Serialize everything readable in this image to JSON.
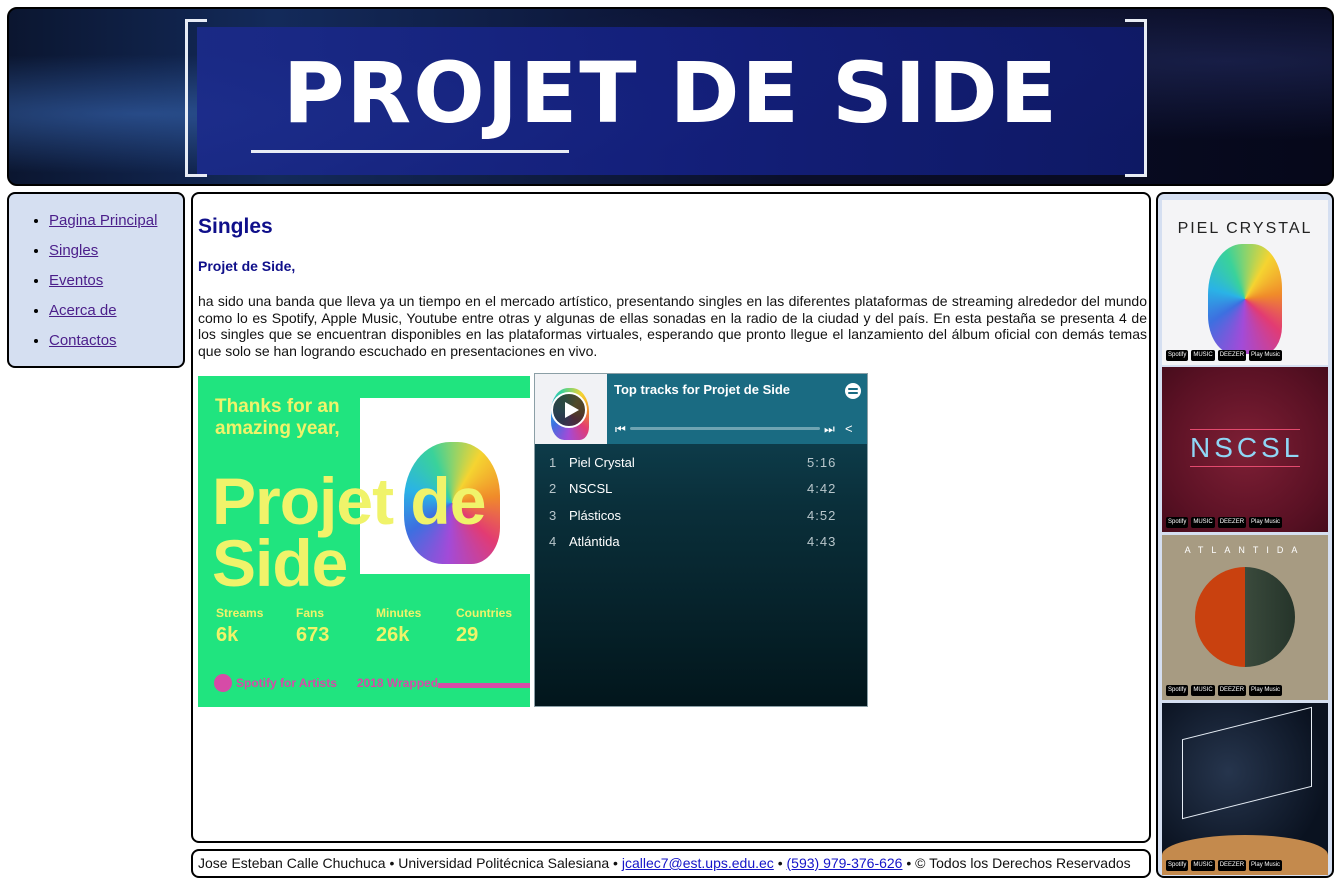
{
  "banner": {
    "title": "PROJET DE SIDE"
  },
  "nav": {
    "items": [
      {
        "label": "Pagina Principal"
      },
      {
        "label": "Singles"
      },
      {
        "label": "Eventos"
      },
      {
        "label": "Acerca de"
      },
      {
        "label": "Contactos"
      }
    ]
  },
  "main": {
    "heading": "Singles",
    "subheading": "Projet de Side,",
    "intro": "ha sido una banda que lleva ya un tiempo en el mercado artístico, presentando singles en las diferentes plataformas de streaming alrededor del mundo como lo es Spotify, Apple Music, Youtube entre otras y algunas de ellas sonadas en la radio de la ciudad y del país. En esta pestaña se presenta 4 de los singles que se encuentran disponibles en las plataformas virtuales, esperando que pronto llegue el lanzamiento del álbum oficial con demás temas que solo se han logrando escuchado en presentaciones en vivo.",
    "wrapped": {
      "thanks": "Thanks for an amazing year,",
      "artist": "Projet de Side",
      "stats": [
        {
          "label": "Streams",
          "value": "6k"
        },
        {
          "label": "Fans",
          "value": "673"
        },
        {
          "label": "Minutes",
          "value": "26k"
        },
        {
          "label": "Countries",
          "value": "29"
        }
      ],
      "brand": "Spotify for Artists",
      "tag": "2018 Wrapped"
    },
    "player": {
      "title": "Top tracks for Projet de Side",
      "tracks": [
        {
          "num": "1",
          "name": "Piel Crystal",
          "duration": "5:16"
        },
        {
          "num": "2",
          "name": "NSCSL",
          "duration": "4:42"
        },
        {
          "num": "3",
          "name": "Plásticos",
          "duration": "4:52"
        },
        {
          "num": "4",
          "name": "Atlántida",
          "duration": "4:43"
        }
      ]
    }
  },
  "aside": {
    "covers": [
      {
        "caption": "PIEL CRYSTAL"
      },
      {
        "caption": "NSCSL"
      },
      {
        "caption": "ATLANTIDA"
      },
      {
        "caption": ""
      }
    ],
    "badges": [
      "Spotify",
      "MUSIC",
      "DEEZER",
      "Play Music"
    ]
  },
  "footer": {
    "author": "Jose Esteban Calle Chuchuca",
    "separator": " • ",
    "university": "Universidad Politécnica Salesiana",
    "email": "jcallec7@est.ups.edu.ec",
    "phone": "(593) 979-376-626",
    "rights": "© Todos los Derechos Reservados"
  }
}
